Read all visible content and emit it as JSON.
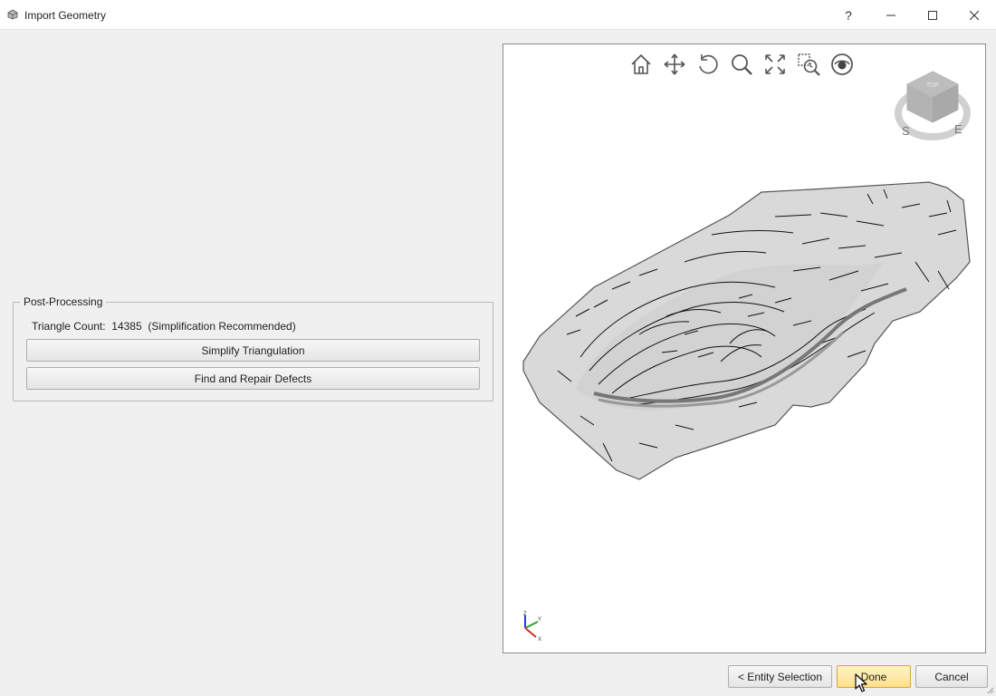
{
  "window": {
    "title": "Import Geometry",
    "help_label": "?"
  },
  "post_processing": {
    "legend": "Post-Processing",
    "triangle_count_label": "Triangle Count:",
    "triangle_count_value": "14385",
    "triangle_count_note": "(Simplification Recommended)",
    "simplify_label": "Simplify Triangulation",
    "repair_label": "Find and Repair Defects"
  },
  "viewer": {
    "toolbar": [
      "home-icon",
      "pan-icon",
      "rotate-icon",
      "zoom-icon",
      "zoom-extents-icon",
      "zoom-window-icon",
      "view-icon"
    ],
    "nav_cube": {
      "top_label": "TOP",
      "south_label": "S",
      "east_label": "E"
    },
    "axes": {
      "x": "X",
      "y": "Y",
      "z": "Z"
    },
    "colors": {
      "x_axis": "#d42a2a",
      "y_axis": "#2aa52a",
      "z_axis": "#2a3fd4",
      "mesh": "#d9d9d9"
    }
  },
  "footer": {
    "back_label": "< Entity Selection",
    "done_label": "Done",
    "cancel_label": "Cancel"
  },
  "colors": {
    "accent_button": "#fde08a",
    "background": "#f0f0f0"
  }
}
